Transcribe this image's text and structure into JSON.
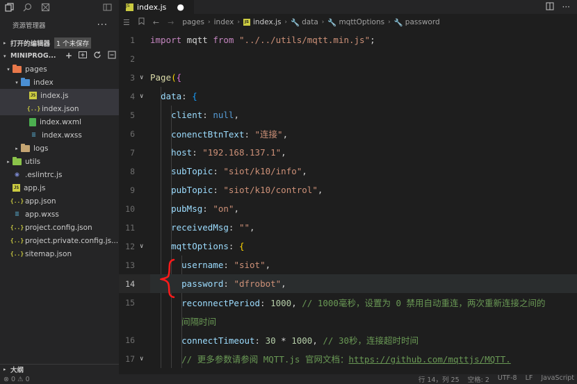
{
  "sidebar": {
    "title": "资源管理器",
    "more": "···",
    "open_editors": {
      "label": "打开的编辑器",
      "badge": "1 个未保存"
    },
    "project": {
      "label": "MINIPROG..."
    },
    "tree": [
      {
        "label": "pages",
        "depth": 1,
        "type": "folder-orange",
        "twisty": "▾"
      },
      {
        "label": "index",
        "depth": 2,
        "type": "folder-blue",
        "twisty": "▾"
      },
      {
        "label": "index.js",
        "depth": 3,
        "type": "js",
        "icon": "JS",
        "selected": true
      },
      {
        "label": "index.json",
        "depth": 3,
        "type": "json",
        "icon": "{..}",
        "selected": true
      },
      {
        "label": "index.wxml",
        "depth": 3,
        "type": "wxml",
        "icon": ""
      },
      {
        "label": "index.wxss",
        "depth": 3,
        "type": "wxss",
        "icon": "≡"
      },
      {
        "label": "logs",
        "depth": 2,
        "type": "folder-plain",
        "twisty": "▸"
      },
      {
        "label": "utils",
        "depth": 1,
        "type": "folder-green",
        "twisty": "▸"
      },
      {
        "label": ".eslintrc.js",
        "depth": 1,
        "type": "eslint",
        "icon": "◉"
      },
      {
        "label": "app.js",
        "depth": 1,
        "type": "js",
        "icon": "JS"
      },
      {
        "label": "app.json",
        "depth": 1,
        "type": "json",
        "icon": "{..}"
      },
      {
        "label": "app.wxss",
        "depth": 1,
        "type": "wxss",
        "icon": "≡"
      },
      {
        "label": "project.config.json",
        "depth": 1,
        "type": "json",
        "icon": "{..}"
      },
      {
        "label": "project.private.config.js...",
        "depth": 1,
        "type": "json",
        "icon": "{..}"
      },
      {
        "label": "sitemap.json",
        "depth": 1,
        "type": "json",
        "icon": "{..}"
      }
    ],
    "outline_label": "大纲"
  },
  "tab": {
    "label": "index.js",
    "icon": "JS",
    "dirty": "●"
  },
  "breadcrumb": [
    "pages",
    "index",
    "index.js",
    "data",
    "mqttOptions",
    "password"
  ],
  "code": {
    "current_line": 14,
    "lines": [
      {
        "n": "1",
        "html": "<span class='kw'>import</span> mqtt <span class='kw'>from</span> <span class='s'>\"../../utils/mqtt.min.js\"</span>;"
      },
      {
        "n": "2",
        "html": ""
      },
      {
        "n": "3",
        "html": "<span class='f'>Page</span><span class='y'>(</span><span class='pk'>{</span>",
        "fold": true
      },
      {
        "n": "4",
        "html": "  <span class='p'>data</span>: <span class='bl'>{</span>",
        "fold": true
      },
      {
        "n": "5",
        "html": "    <span class='p'>client</span>: <span class='k'>null</span>,"
      },
      {
        "n": "6",
        "html": "    <span class='p'>conenctBtnText</span>: <span class='s'>\"连接\"</span>,"
      },
      {
        "n": "7",
        "html": "    <span class='p'>host</span>: <span class='s'>\"192.168.137.1\"</span>,"
      },
      {
        "n": "8",
        "html": "    <span class='p'>subTopic</span>: <span class='s'>\"siot/k10/info\"</span>,"
      },
      {
        "n": "9",
        "html": "    <span class='p'>pubTopic</span>: <span class='s'>\"siot/k10/control\"</span>,"
      },
      {
        "n": "10",
        "html": "    <span class='p'>pubMsg</span>: <span class='s'>\"on\"</span>,"
      },
      {
        "n": "11",
        "html": "    <span class='p'>receivedMsg</span>: <span class='s'>\"\"</span>,"
      },
      {
        "n": "12",
        "html": "    <span class='p'>mqttOptions</span>: <span class='y'>{</span>",
        "fold": true
      },
      {
        "n": "13",
        "html": "      <span class='p'>username</span>: <span class='s'>\"siot\"</span>,"
      },
      {
        "n": "14",
        "html": "      <span class='p'>password</span>: <span class='s'>\"dfrobot\"</span>,"
      },
      {
        "n": "15",
        "html": "      <span class='p'>reconnectPeriod</span>: <span class='n'>1000</span>, <span class='c'>// 1000毫秒，设置为 0 禁用自动重连，两次重新连接之间的</span>"
      },
      {
        "n": "",
        "html": "      <span class='c'>间隔时间</span>"
      },
      {
        "n": "16",
        "html": "      <span class='p'>connectTimeout</span>: <span class='n'>30</span> * <span class='n'>1000</span>, <span class='c'>// 30秒，连接超时时间</span>"
      },
      {
        "n": "17",
        "html": "      <span class='c'>// 更多参数请参阅 MQTT.js 官网文档：<span class='u'>https://github.com/mqttjs/MQTT.</span></span>",
        "fold": true
      }
    ]
  },
  "status": {
    "left": "⊗ 0 ⚠ 0",
    "position": "行 14，列 25",
    "spaces": "空格: 2",
    "encoding": "UTF-8",
    "eol": "LF",
    "language": "JavaScript"
  }
}
